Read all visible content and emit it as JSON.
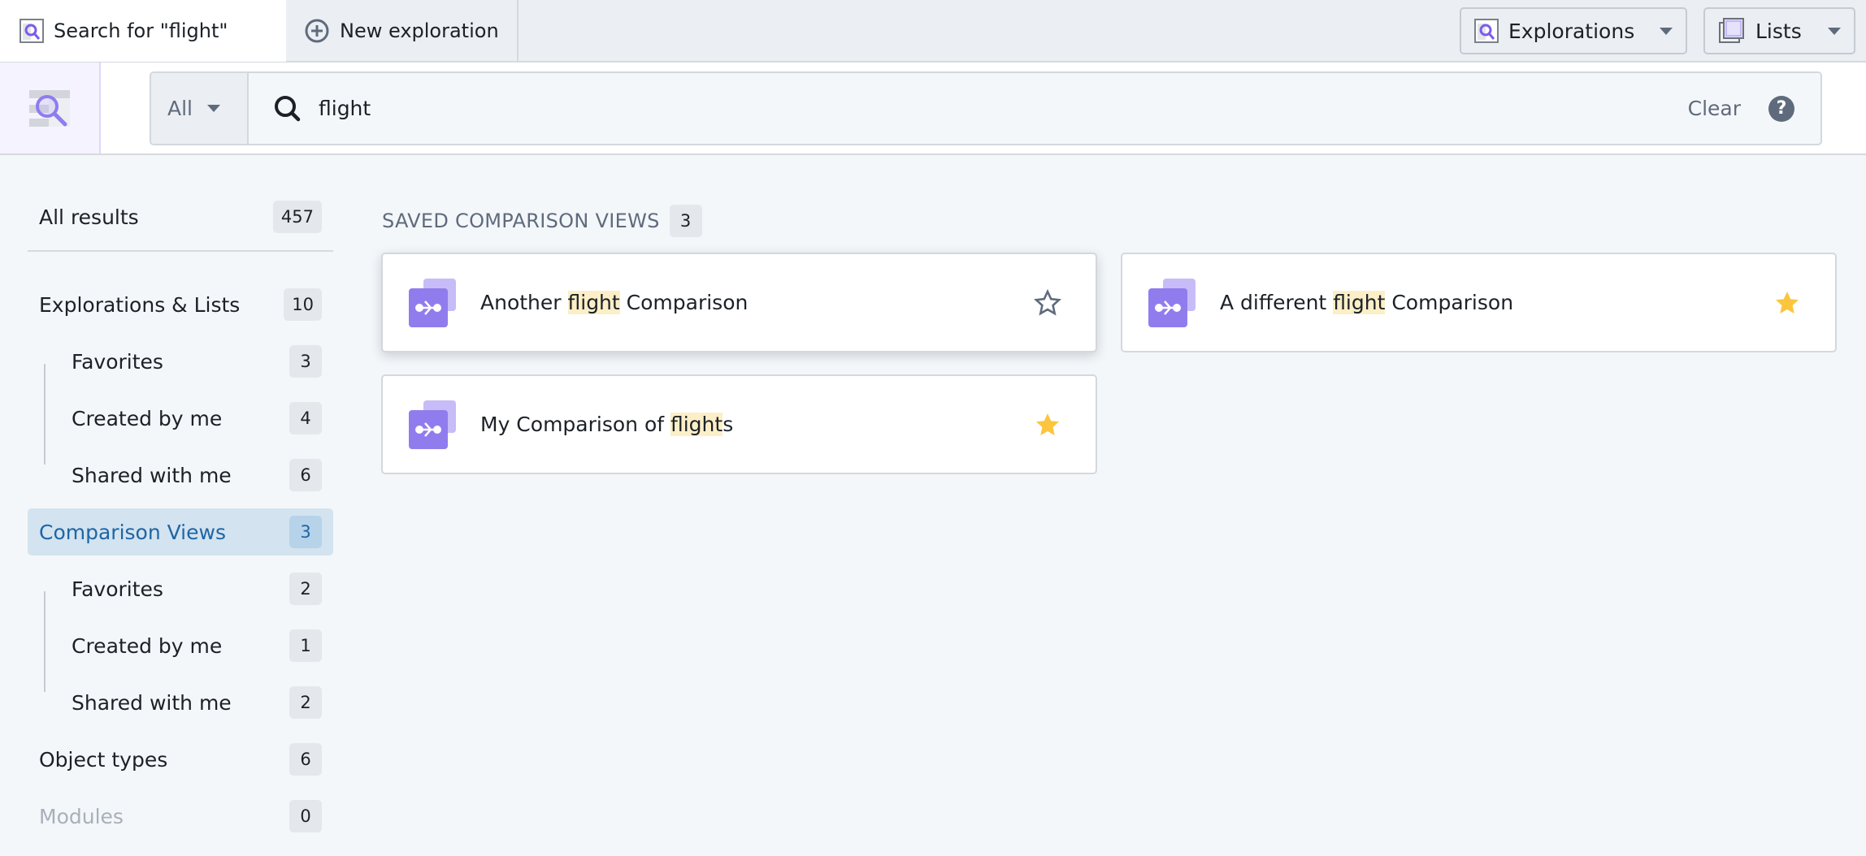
{
  "topbar": {
    "tabs": [
      {
        "label": "Search for \"flight\"",
        "icon": "search-document-icon",
        "active": true
      },
      {
        "label": "New exploration",
        "icon": "plus-circle-icon",
        "active": false
      }
    ],
    "explorations_button": {
      "label": "Explorations",
      "icon": "search-document-icon"
    },
    "lists_button": {
      "label": "Lists",
      "icon": "stacked-list-icon"
    }
  },
  "search": {
    "scope": "All",
    "query": "flight",
    "clear_label": "Clear",
    "help_icon": "question-icon"
  },
  "sidebar": {
    "all_results": {
      "label": "All results",
      "count": "457"
    },
    "groups": [
      {
        "label": "Explorations & Lists",
        "count": "10",
        "active": false,
        "disabled": false,
        "children": [
          {
            "label": "Favorites",
            "count": "3"
          },
          {
            "label": "Created by me",
            "count": "4"
          },
          {
            "label": "Shared with me",
            "count": "6"
          }
        ]
      },
      {
        "label": "Comparison Views",
        "count": "3",
        "active": true,
        "disabled": false,
        "children": [
          {
            "label": "Favorites",
            "count": "2"
          },
          {
            "label": "Created by me",
            "count": "1"
          },
          {
            "label": "Shared with me",
            "count": "2"
          }
        ]
      },
      {
        "label": "Object types",
        "count": "6",
        "active": false,
        "disabled": false,
        "children": []
      },
      {
        "label": "Modules",
        "count": "0",
        "active": false,
        "disabled": true,
        "children": []
      }
    ]
  },
  "main": {
    "section_title": "SAVED COMPARISON VIEWS",
    "section_count": "3",
    "cards": [
      {
        "title_parts": [
          "Another ",
          "flight",
          " Comparison"
        ],
        "favorited": false,
        "hovered": true
      },
      {
        "title_parts": [
          "A different ",
          "flight",
          " Comparison"
        ],
        "favorited": true,
        "hovered": false
      },
      {
        "title_parts": [
          "My Comparison of ",
          "flight",
          "s"
        ],
        "favorited": true,
        "hovered": false
      }
    ]
  },
  "colors": {
    "accent_purple": "#8f7cee",
    "accent_purple_light": "#c7bcf7",
    "active_blue": "#1e66a4",
    "active_bg": "#d3e3f0",
    "highlight": "#fcefc7",
    "star_gold": "#fbc53e",
    "star_outline": "#5f6b7c"
  }
}
